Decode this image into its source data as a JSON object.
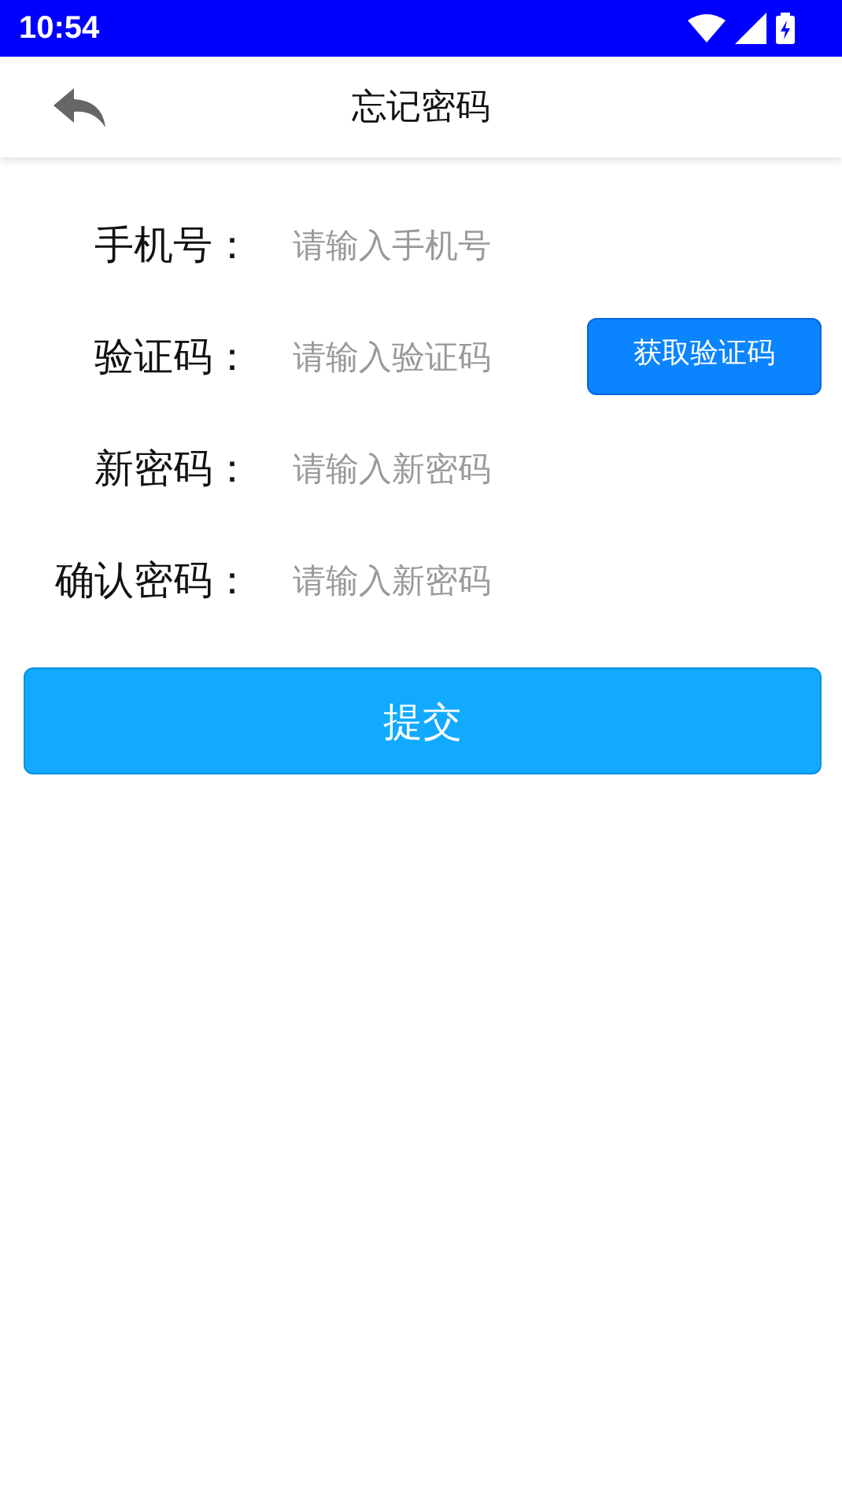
{
  "status_bar": {
    "time": "10:54"
  },
  "header": {
    "title": "忘记密码"
  },
  "fields": [
    {
      "label": "手机号：",
      "placeholder": "请输入手机号"
    },
    {
      "label": "验证码：",
      "placeholder": "请输入验证码",
      "button": "获取验证码"
    },
    {
      "label": "新密码：",
      "placeholder": "请输入新密码"
    },
    {
      "label": "确认密码：",
      "placeholder": "请输入新密码"
    }
  ],
  "submit": "提交"
}
